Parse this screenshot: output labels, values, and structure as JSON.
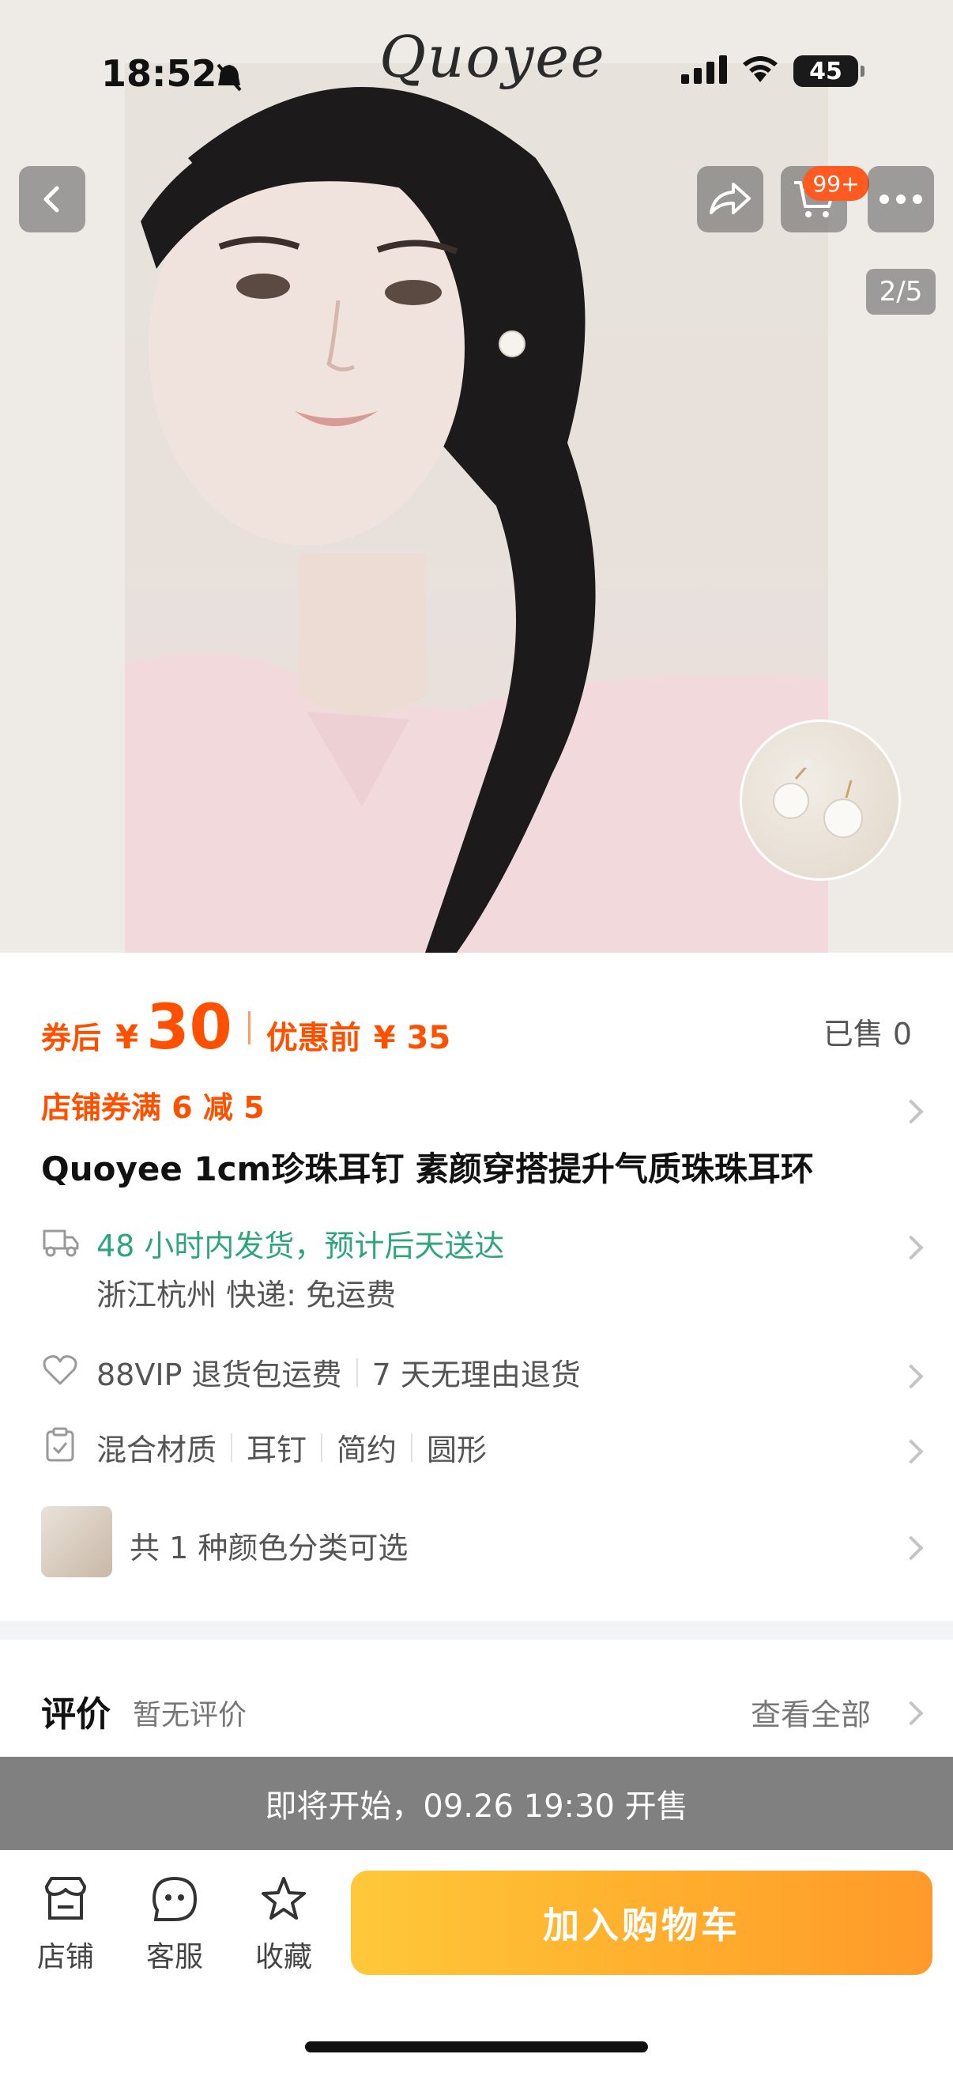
{
  "status_bar": {
    "time": "18:52",
    "battery": "45"
  },
  "hero": {
    "brand": "Quoyee",
    "cart_badge": "99+",
    "page_counter": "2/5"
  },
  "product": {
    "price_label": "券后",
    "currency": "¥",
    "price": "30",
    "orig_label": "优惠前",
    "orig_price": "¥ 35",
    "sold": "已售 0",
    "coupon": "店铺券满 6 减 5",
    "title": "Quoyee 1cm珍珠耳钉 素颜穿搭提升气质珠珠耳环"
  },
  "shipping": {
    "line1": "48 小时内发货，预计后天送达",
    "line2": "浙江杭州  快递: 免运费"
  },
  "services": [
    "88VIP 退货包运费",
    "7 天无理由退货"
  ],
  "attributes": [
    "混合材质",
    "耳钉",
    "简约",
    "圆形"
  ],
  "variant": {
    "text": "共 1 种颜色分类可选"
  },
  "review": {
    "title": "评价",
    "subtitle": "暂无评价",
    "view_all": "查看全部"
  },
  "presale": {
    "text": "即将开始，09.26 19:30 开售"
  },
  "bottom_bar": {
    "store": "店铺",
    "service": "客服",
    "favorite": "收藏",
    "add_to_cart": "加入购物车"
  },
  "colors": {
    "accent": "#ff5000",
    "green": "#2fa67a",
    "cta_start": "#ffc83a",
    "cta_end": "#ff9a2a",
    "presale_bg": "#808080"
  }
}
